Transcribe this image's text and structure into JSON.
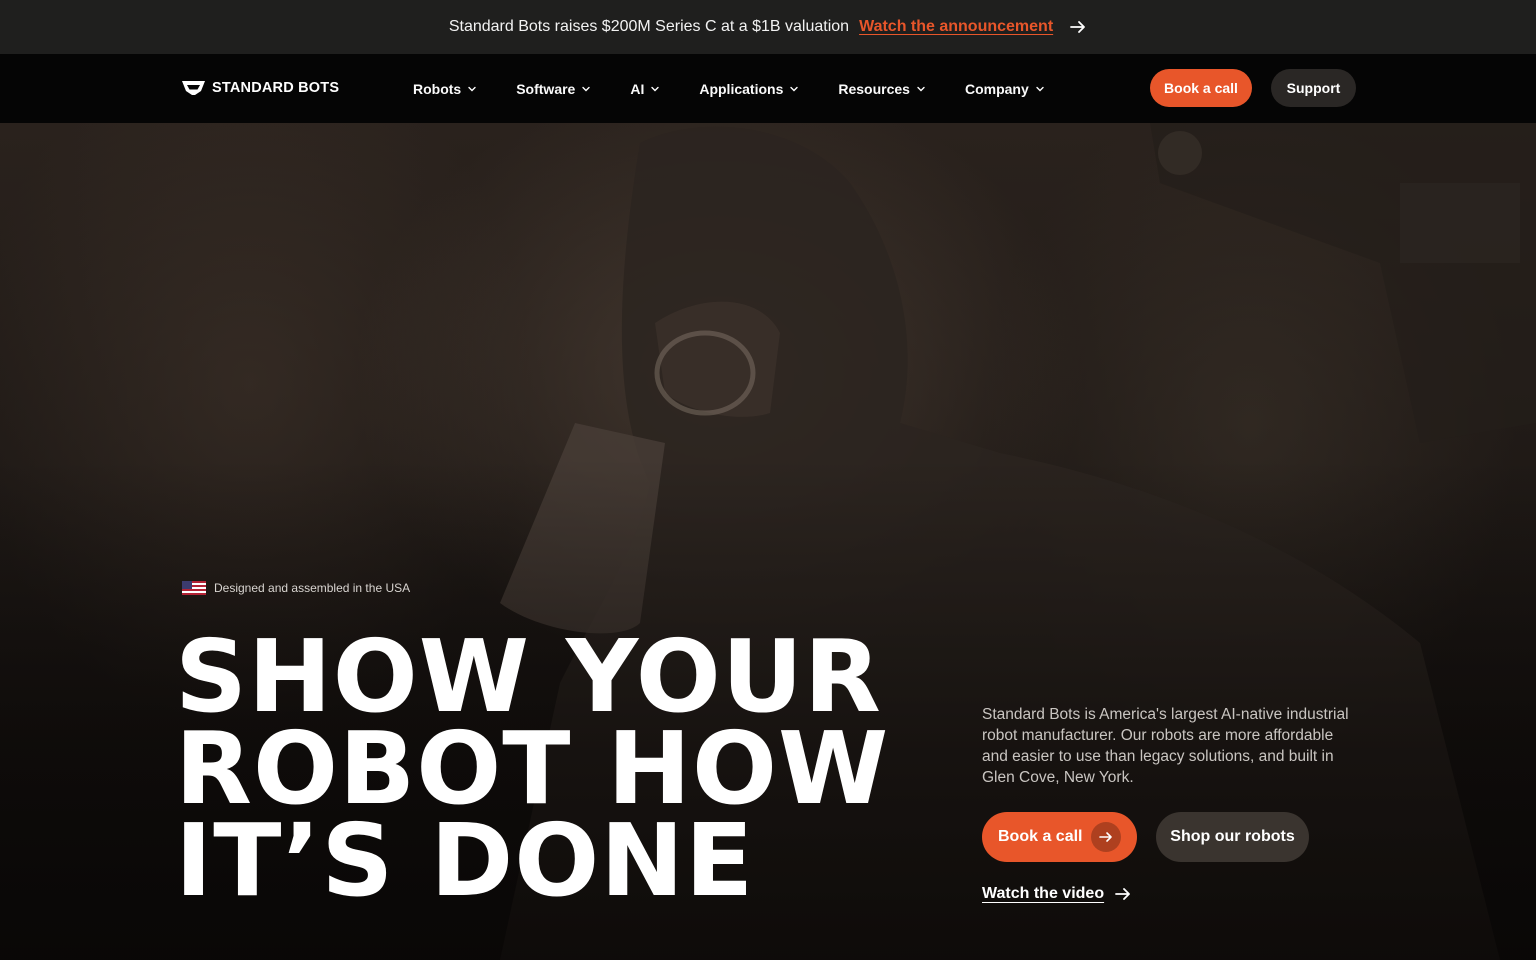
{
  "announcement": {
    "message": "Standard Bots raises $200M Series C at a $1B valuation",
    "link_label": "Watch the announcement",
    "icon": "arrow-right-icon"
  },
  "nav": {
    "brand": "STANDARD BOTS",
    "menu": [
      {
        "label": "Robots"
      },
      {
        "label": "Software"
      },
      {
        "label": "AI"
      },
      {
        "label": "Applications"
      },
      {
        "label": "Resources"
      },
      {
        "label": "Company"
      }
    ],
    "book_label": "Book a call",
    "support_label": "Support"
  },
  "hero": {
    "badge": "Designed and assembled in the USA",
    "headline": [
      "SHOW YOUR",
      "ROBOT HOW",
      "IT’S DONE"
    ],
    "description": "Standard Bots is America's largest AI-native industrial robot manufacturer. Our robots are more affordable and easier to use than legacy solutions, and built in Glen Cove, New York.",
    "book_label": "Book a call",
    "shop_label": "Shop our robots",
    "video_label": "Watch the video"
  },
  "colors": {
    "accent": "#e8562a",
    "nav_bg": "#050505",
    "announce_bg": "#1f1f1e"
  }
}
